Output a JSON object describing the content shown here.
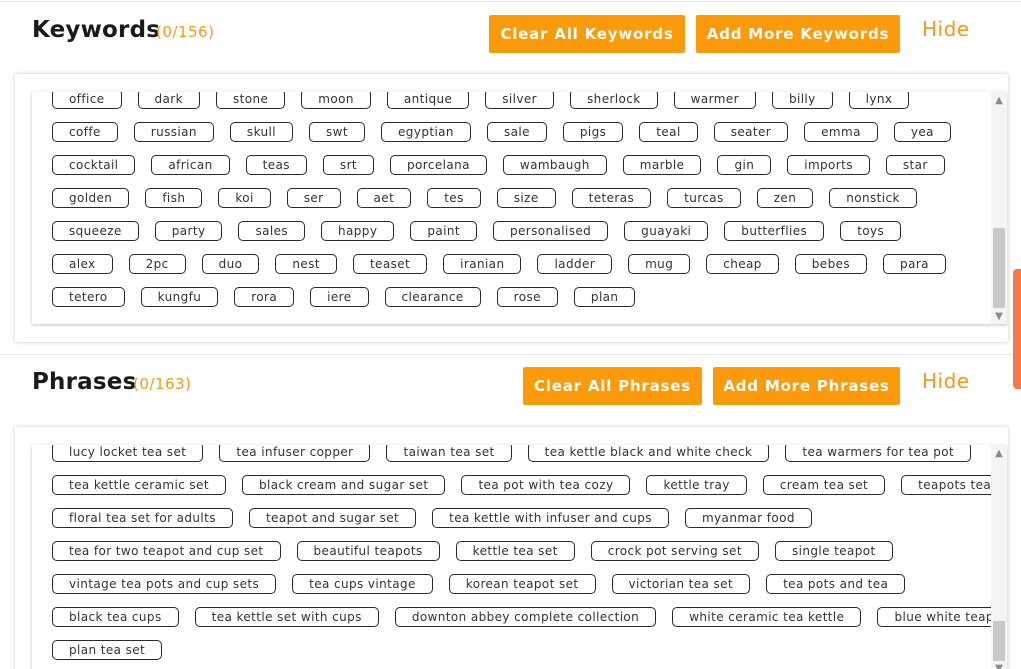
{
  "keywords": {
    "title": "Keywords",
    "count": "(0/156)",
    "clear_label": "Clear All Keywords",
    "add_label": "Add More Keywords",
    "hide_label": "Hide",
    "rows": [
      [
        "office",
        "dark",
        "stone",
        "moon",
        "antique",
        "silver",
        "sherlock",
        "warmer",
        "billy",
        "lynx"
      ],
      [
        "coffe",
        "russian",
        "skull",
        "swt",
        "egyptian",
        "sale",
        "pigs",
        "teal",
        "seater",
        "emma",
        "yea"
      ],
      [
        "cocktail",
        "african",
        "teas",
        "srt",
        "porcelana",
        "wambaugh",
        "marble",
        "gin",
        "imports",
        "star"
      ],
      [
        "golden",
        "fish",
        "koi",
        "ser",
        "aet",
        "tes",
        "size",
        "teteras",
        "turcas",
        "zen",
        "nonstick"
      ],
      [
        "squeeze",
        "party",
        "sales",
        "happy",
        "paint",
        "personalised",
        "guayaki",
        "butterflies",
        "toys"
      ],
      [
        "alex",
        "2pc",
        "duo",
        "nest",
        "teaset",
        "iranian",
        "ladder",
        "mug",
        "cheap",
        "bebes",
        "para"
      ],
      [
        "tetero",
        "kungfu",
        "rora",
        "iere",
        "clearance",
        "rose",
        "plan"
      ]
    ]
  },
  "phrases": {
    "title": "Phrases",
    "count": "(0/163)",
    "clear_label": "Clear All Phrases",
    "add_label": "Add More Phrases",
    "hide_label": "Hide",
    "rows": [
      [
        "lucy locket tea set",
        "tea infuser copper",
        "taiwan tea set",
        "tea kettle black and white check",
        "tea warmers for tea pot"
      ],
      [
        "tea kettle ceramic set",
        "black cream and sugar set",
        "tea pot with tea cozy",
        "kettle tray",
        "cream tea set",
        "teapots tea"
      ],
      [
        "floral tea set for adults",
        "teapot and sugar set",
        "tea kettle with infuser and cups",
        "myanmar food"
      ],
      [
        "tea for two teapot and cup set",
        "beautiful teapots",
        "kettle tea set",
        "crock pot serving set",
        "single teapot"
      ],
      [
        "vintage tea pots and cup sets",
        "tea cups vintage",
        "korean teapot set",
        "victorian tea set",
        "tea pots and tea"
      ],
      [
        "black tea cups",
        "tea kettle set with cups",
        "downton abbey complete collection",
        "white ceramic tea kettle",
        "blue white teapot"
      ],
      [
        "plan tea set"
      ]
    ]
  },
  "scroll_up_icon": "chevron-up-icon",
  "scroll_down_icon": "chevron-down-icon",
  "colors": {
    "accent": "#fb9b0c",
    "accent_text": "#f39a17",
    "side_accent": "#f07b4b"
  }
}
